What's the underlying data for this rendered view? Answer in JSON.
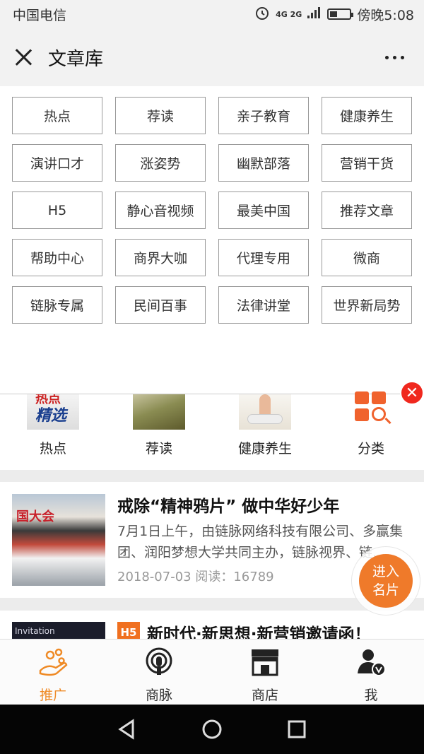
{
  "status_bar": {
    "carrier": "中国电信",
    "network": "4G 2G",
    "time": "傍晚5:08"
  },
  "header": {
    "title": "文章库"
  },
  "categories": [
    "热点",
    "荐读",
    "亲子教育",
    "健康养生",
    "演讲口才",
    "涨姿势",
    "幽默部落",
    "营销干货",
    "H5",
    "静心音视频",
    "最美中国",
    "推荐文章",
    "帮助中心",
    "商界大咖",
    "代理专用",
    "微商",
    "链脉专属",
    "民间百事",
    "法律讲堂",
    "世界新局势"
  ],
  "quick_nav": [
    {
      "label": "热点",
      "img_text_top": "热点",
      "img_text_main": "精选"
    },
    {
      "label": "荐读"
    },
    {
      "label": "健康养生"
    },
    {
      "label": "分类"
    }
  ],
  "articles": [
    {
      "title": "戒除“精神鸦片” 做中华好少年",
      "desc": "7月1日上午，由链脉网络科技有限公司、多赢集团、润阳梦想大学共同主办，链脉视界、链...",
      "date": "2018-07-03",
      "reads_label": "阅读：",
      "reads": "16789",
      "thumb_text": "国大会"
    },
    {
      "title": "新时代·新思想·新营销邀请函！",
      "badge": "H5",
      "thumb_text": "Invitation"
    }
  ],
  "fab": {
    "line1": "进入",
    "line2": "名片"
  },
  "tab_bar": [
    {
      "label": "推广",
      "icon": "promote-hand-icon",
      "active": true
    },
    {
      "label": "商脉",
      "icon": "podcast-icon"
    },
    {
      "label": "商店",
      "icon": "store-icon"
    },
    {
      "label": "我",
      "icon": "user-verified-icon"
    }
  ],
  "colors": {
    "accent": "#ef8a25",
    "fab": "#ef7a2a",
    "close_red": "#f0281e"
  }
}
